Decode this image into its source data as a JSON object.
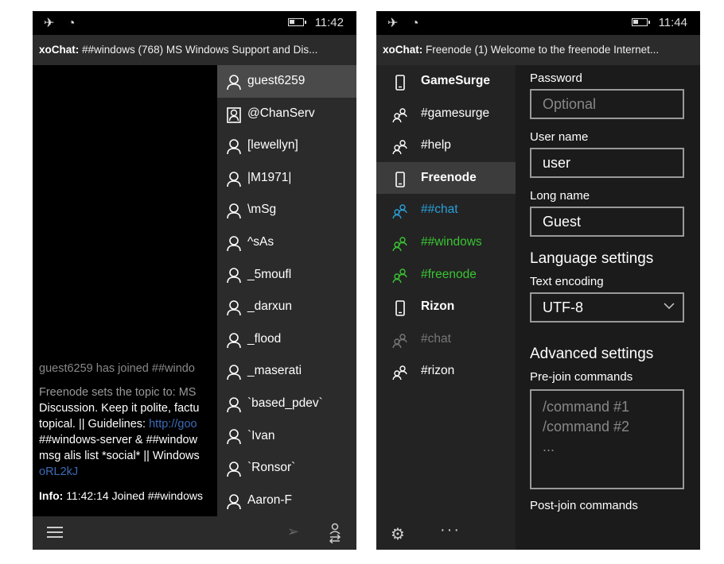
{
  "left_screen": {
    "status": {
      "time": "11:42"
    },
    "title": {
      "app": "xoChat:",
      "text": "##windows (768) MS Windows Support and Dis..."
    },
    "messages": {
      "join": "guest6259 has joined ##windo",
      "topic_line1": "Freenode sets the topic to: MS",
      "topic_line2": "Discussion. Keep it polite, factu",
      "topic_line3_a": "topical. || Guidelines: ",
      "topic_line3_link": "http://goo",
      "topic_line4": "##windows-server & ##window",
      "topic_line5": "msg alis list *social* || Windows",
      "topic_line6_link": "oRL2kJ",
      "info_label": "Info:",
      "info_text": "11:42:14 Joined ##windows"
    },
    "users": [
      {
        "nick": "guest6259",
        "selected": true,
        "icon": "person-icon"
      },
      {
        "nick": "@ChanServ",
        "selected": false,
        "icon": "operator-icon"
      },
      {
        "nick": "[lewellyn]",
        "selected": false,
        "icon": "person-icon"
      },
      {
        "nick": "|M1971|",
        "selected": false,
        "icon": "person-icon"
      },
      {
        "nick": "\\mSg",
        "selected": false,
        "icon": "person-icon"
      },
      {
        "nick": "^sAs",
        "selected": false,
        "icon": "person-icon"
      },
      {
        "nick": "_5moufl",
        "selected": false,
        "icon": "person-icon"
      },
      {
        "nick": "_darxun",
        "selected": false,
        "icon": "person-icon"
      },
      {
        "nick": "_flood",
        "selected": false,
        "icon": "person-icon"
      },
      {
        "nick": "_maserati",
        "selected": false,
        "icon": "person-icon"
      },
      {
        "nick": "`based_pdev`",
        "selected": false,
        "icon": "person-icon"
      },
      {
        "nick": "`Ivan",
        "selected": false,
        "icon": "person-icon"
      },
      {
        "nick": "`Ronsor`",
        "selected": false,
        "icon": "person-icon"
      },
      {
        "nick": "Aaron-F",
        "selected": false,
        "icon": "person-icon"
      }
    ]
  },
  "right_screen": {
    "status": {
      "time": "11:44"
    },
    "title": {
      "app": "xoChat:",
      "text": "Freenode (1) Welcome to the freenode Internet..."
    },
    "networks": [
      {
        "label": "GameSurge",
        "kind": "server",
        "selected": false,
        "color": "#ffffff"
      },
      {
        "label": "#gamesurge",
        "kind": "channel",
        "selected": false,
        "color": "#ffffff"
      },
      {
        "label": "#help",
        "kind": "channel",
        "selected": false,
        "color": "#ffffff"
      },
      {
        "label": "Freenode",
        "kind": "server",
        "selected": true,
        "color": "#ffffff"
      },
      {
        "label": "##chat",
        "kind": "channel",
        "selected": false,
        "color": "#2a9fd8"
      },
      {
        "label": "##windows",
        "kind": "channel",
        "selected": false,
        "color": "#39c432"
      },
      {
        "label": "#freenode",
        "kind": "channel",
        "selected": false,
        "color": "#39c432"
      },
      {
        "label": "Rizon",
        "kind": "server",
        "selected": false,
        "color": "#ffffff"
      },
      {
        "label": "#chat",
        "kind": "channel",
        "selected": false,
        "color": "#777777"
      },
      {
        "label": "#rizon",
        "kind": "channel",
        "selected": false,
        "color": "#ffffff"
      }
    ],
    "settings": {
      "password_label": "Password",
      "password_placeholder": "Optional",
      "username_label": "User name",
      "username_value": "user",
      "longname_label": "Long name",
      "longname_value": "Guest",
      "language_heading": "Language settings",
      "encoding_label": "Text encoding",
      "encoding_value": "UTF-8",
      "advanced_heading": "Advanced settings",
      "prejoin_label": "Pre-join commands",
      "prejoin_line1": "/command #1",
      "prejoin_line2": "/command #2",
      "prejoin_line3": "...",
      "postjoin_label": "Post-join commands"
    }
  }
}
